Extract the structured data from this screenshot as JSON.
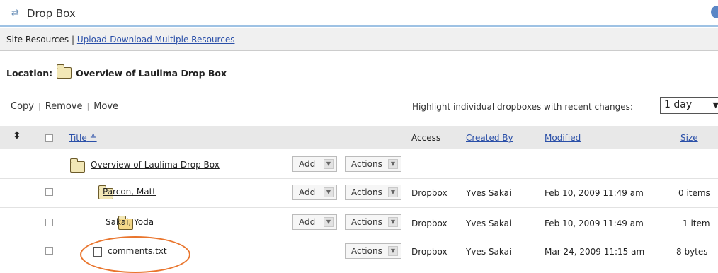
{
  "header": {
    "title": "Drop Box",
    "tool_icon": "refresh-icon",
    "help_icon": "help-icon"
  },
  "nav": {
    "site_resources": "Site Resources",
    "separator": "|",
    "upload_download": "Upload-Download Multiple Resources"
  },
  "location": {
    "label": "Location:",
    "folder_name": "Overview of Laulima Drop Box"
  },
  "toolbar": {
    "copy": "Copy",
    "remove": "Remove",
    "move": "Move",
    "pipe": "|",
    "highlight_label": "Highlight individual dropboxes with recent changes:",
    "highlight_value": "1 day"
  },
  "table": {
    "headers": {
      "title": "Title",
      "access": "Access",
      "created_by": "Created By",
      "modified": "Modified",
      "size": "Size"
    },
    "rows": [
      {
        "title": "Overview of Laulima Drop Box",
        "add": "Add",
        "actions": "Actions",
        "access": "",
        "created_by": "",
        "modified": "",
        "size": ""
      },
      {
        "title": "Parcon, Matt",
        "add": "Add",
        "actions": "Actions",
        "access": "Dropbox",
        "created_by": "Yves Sakai",
        "modified": "Feb 10, 2009 11:49 am",
        "size": "0 items"
      },
      {
        "title": "Sakai, Yoda",
        "add": "Add",
        "actions": "Actions",
        "access": "Dropbox",
        "created_by": "Yves Sakai",
        "modified": "Feb 10, 2009 11:49 am",
        "size": "1 item"
      },
      {
        "title": "comments.txt",
        "add": "",
        "actions": "Actions",
        "access": "Dropbox",
        "created_by": "Yves Sakai",
        "modified": "Mar 24, 2009 11:15 am",
        "size": "8 bytes"
      }
    ]
  },
  "colors": {
    "link": "#2a4fa8",
    "header_rule": "#9ec2e4",
    "annotation": "#e9752d"
  }
}
